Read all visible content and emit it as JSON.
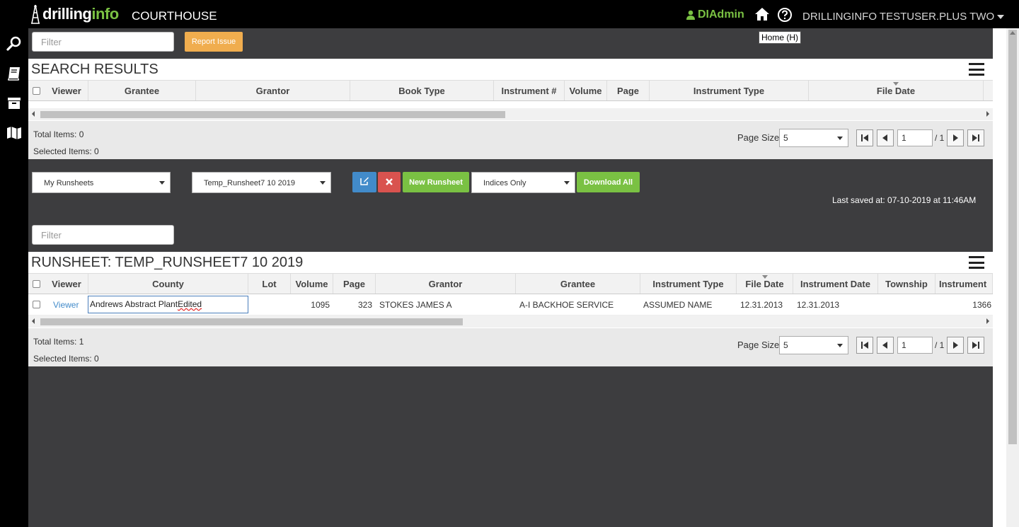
{
  "header": {
    "logo_part1": "drilling",
    "logo_part2": "info",
    "app_title": "COURTHOUSE",
    "admin_label": "DIAdmin",
    "home_tooltip": "Home (H)",
    "user_name": "DRILLINGINFO TESTUSER.PLUS TWO"
  },
  "toolbar": {
    "filter_placeholder": "Filter",
    "report_issue_label": "Report Issue"
  },
  "search_results": {
    "title": "SEARCH RESULTS",
    "columns": [
      "Viewer",
      "Grantee",
      "Grantor",
      "Book Type",
      "Instrument #",
      "Volume",
      "Page",
      "Instrument Type",
      "File Date"
    ],
    "total_items": "Total Items: 0",
    "selected_items": "Selected Items: 0",
    "page_size_label": "Page Size:",
    "page_size": "5",
    "page": "1",
    "page_of": "/ 1"
  },
  "runsheet_controls": {
    "runsheet_list_select": "My Runsheets",
    "runsheet_select": "Temp_Runsheet7 10 2019",
    "new_runsheet_label": "New Runsheet",
    "view_mode_select": "Indices Only",
    "download_all_label": "Download All",
    "last_saved": "Last saved at: 07-10-2019 at 11:46AM",
    "filter_placeholder": "Filter"
  },
  "runsheet": {
    "title": "RUNSHEET: TEMP_RUNSHEET7 10 2019",
    "columns": [
      "Viewer",
      "County",
      "Lot",
      "Volume",
      "Page",
      "Grantor",
      "Grantee",
      "Instrument Type",
      "File Date",
      "Instrument Date",
      "Township",
      "Instrument"
    ],
    "rows": [
      {
        "viewer": "Viewer",
        "county_edit": "Andrews Abstract Plant",
        "county_edit_suffix": "Edited",
        "lot": "",
        "volume": "1095",
        "page": "323",
        "grantor": "STOKES JAMES A",
        "grantee": "A-I BACKHOE SERVICE",
        "instrument_type": "ASSUMED NAME",
        "file_date": "12.31.2013",
        "instrument_date": "12.31.2013",
        "township": "",
        "instrument": "1366"
      }
    ],
    "total_items": "Total Items: 1",
    "selected_items": "Selected Items: 0",
    "page_size_label": "Page Size:",
    "page_size": "5",
    "page": "1",
    "page_of": "/ 1"
  },
  "colors": {
    "accent_green": "#7ac143",
    "accent_orange": "#f0ad4e",
    "accent_blue": "#428bca",
    "accent_red": "#d9534f",
    "background_dark": "#3d3d3f"
  }
}
